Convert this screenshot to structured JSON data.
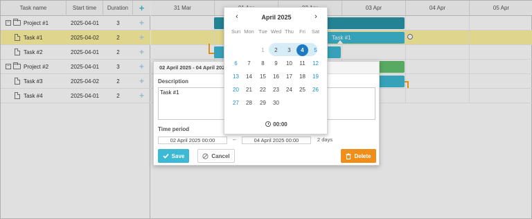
{
  "grid": {
    "headers": {
      "name": "Task name",
      "start": "Start time",
      "duration": "Duration",
      "add": "+"
    },
    "rows": [
      {
        "name": "Project #1",
        "start": "2025-04-01",
        "duration": "3",
        "type": "project",
        "toggle": "−"
      },
      {
        "name": "Task #1",
        "start": "2025-04-02",
        "duration": "2",
        "type": "task",
        "selected": true
      },
      {
        "name": "Task #2",
        "start": "2025-04-01",
        "duration": "2",
        "type": "task"
      },
      {
        "name": "Project #2",
        "start": "2025-04-01",
        "duration": "3",
        "type": "project",
        "toggle": "−"
      },
      {
        "name": "Task #3",
        "start": "2025-04-02",
        "duration": "2",
        "type": "task"
      },
      {
        "name": "Task #4",
        "start": "2025-04-01",
        "duration": "2",
        "type": "task"
      }
    ],
    "add_glyph": "+"
  },
  "scale": {
    "dates": [
      "31 Mar",
      "01 Apr",
      "02 Apr",
      "03 Apr",
      "04 Apr",
      "05 Apr"
    ]
  },
  "bars": {
    "task1_label": "Task #1"
  },
  "lightbox": {
    "title": "02 April 2025 - 04 April 2025",
    "description_label": "Description",
    "description_value": "Task #1",
    "time_period_label": "Time period",
    "start_value": "02 April 2025 00:00",
    "dash": "–",
    "end_value": "04 April 2025 00:00",
    "duration_text": "2 days",
    "save_label": "Save",
    "cancel_label": "Cancel",
    "delete_label": "Delete"
  },
  "datepicker": {
    "month_label": "April 2025",
    "prev": "‹",
    "next": "›",
    "weekdays": [
      "Sun",
      "Mon",
      "Tue",
      "Wed",
      "Thu",
      "Fri",
      "Sat"
    ],
    "weeks": [
      [
        "",
        "",
        "1",
        "2",
        "3",
        "4",
        "5"
      ],
      [
        "6",
        "7",
        "8",
        "9",
        "10",
        "11",
        "12"
      ],
      [
        "13",
        "14",
        "15",
        "16",
        "17",
        "18",
        "19"
      ],
      [
        "20",
        "21",
        "22",
        "23",
        "24",
        "25",
        "26"
      ],
      [
        "27",
        "28",
        "29",
        "30",
        "",
        "",
        ""
      ]
    ],
    "selected_day": "4",
    "time": "00:00"
  },
  "colors": {
    "accent": "#3db9d3",
    "project_bar": "#2895a8",
    "selected_row": "#fff3a1",
    "delete": "#ef8e1a",
    "link": "#ffa011",
    "green_bar": "#65c16f",
    "picker_selected": "#1f7ac4"
  }
}
